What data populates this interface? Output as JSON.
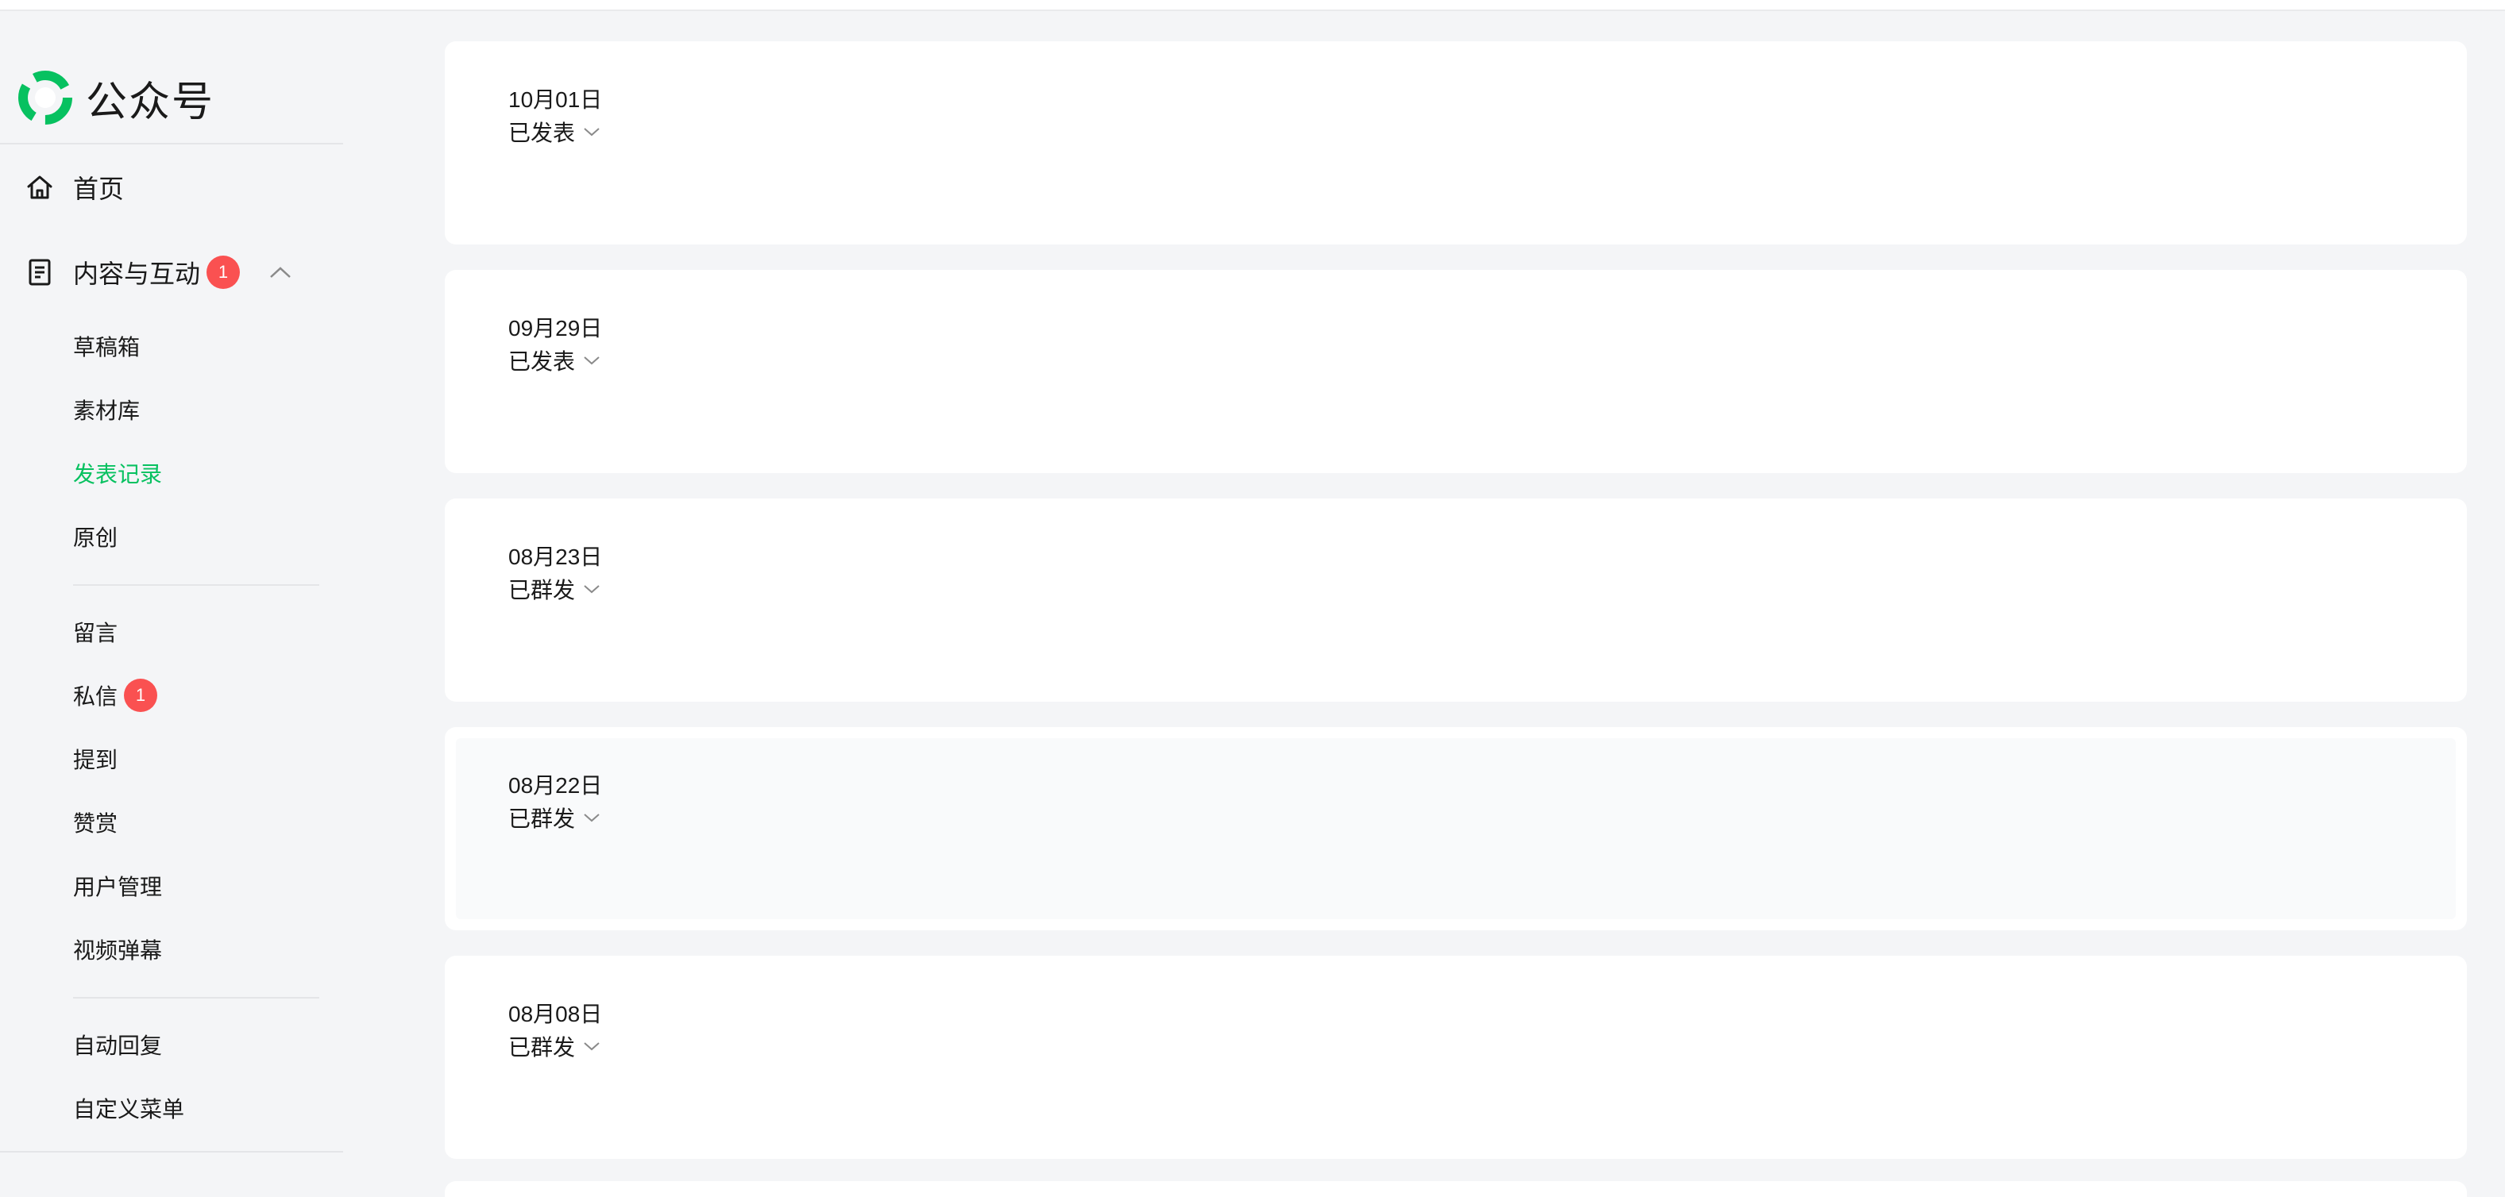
{
  "brand": {
    "name": "公众号",
    "logo_icon": "wechat-official-account-logo",
    "logo_color": "#07c160"
  },
  "nav": {
    "home": {
      "label": "首页",
      "icon": "home-icon"
    },
    "content": {
      "label": "内容与互动",
      "icon": "document-icon",
      "badge": "1",
      "expanded": true,
      "items": [
        {
          "label": "草稿箱"
        },
        {
          "label": "素材库"
        },
        {
          "label": "发表记录",
          "active": true
        },
        {
          "label": "原创"
        }
      ],
      "interaction_items": [
        {
          "label": "留言"
        },
        {
          "label": "私信",
          "badge": "1"
        },
        {
          "label": "提到"
        },
        {
          "label": "赞赏"
        },
        {
          "label": "用户管理"
        },
        {
          "label": "视频弹幕"
        }
      ],
      "auto_items": [
        {
          "label": "自动回复"
        },
        {
          "label": "自定义菜单"
        }
      ]
    }
  },
  "records": [
    {
      "date": "10月01日",
      "status": "已发表"
    },
    {
      "date": "09月29日",
      "status": "已发表"
    },
    {
      "date": "08月23日",
      "status": "已群发"
    },
    {
      "date": "08月22日",
      "status": "已群发"
    },
    {
      "date": "08月08日",
      "status": "已群发"
    }
  ],
  "colors": {
    "accent": "#07c160",
    "badge": "#fa5151",
    "background": "#f4f5f7",
    "card": "#ffffff"
  }
}
